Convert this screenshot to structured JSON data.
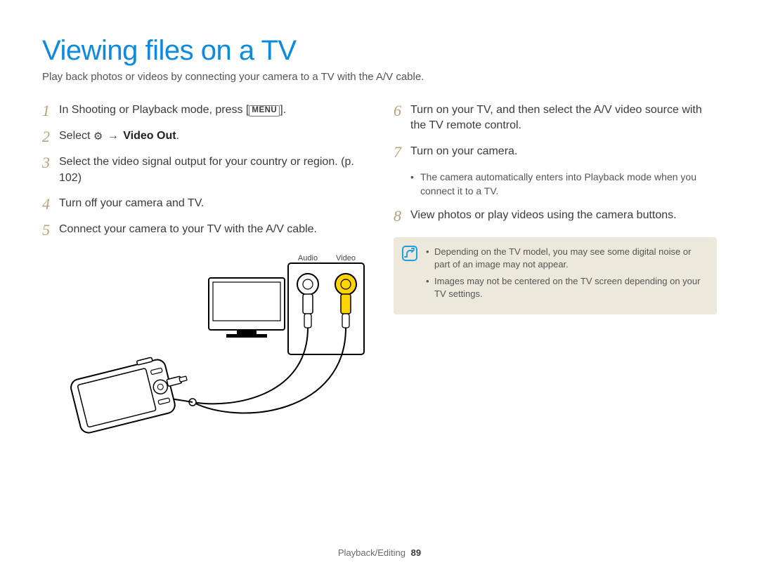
{
  "title": "Viewing files on a TV",
  "intro": "Play back photos or videos by connecting your camera to a TV with the A/V cable.",
  "left_steps": [
    {
      "num": "1",
      "text_pre": "In Shooting or Playback mode, press [",
      "menu_label": "MENU",
      "text_post": "]."
    },
    {
      "num": "2",
      "text_pre": "Select ",
      "gear": "⚙",
      "arrow": "→",
      "bold": "Video Out",
      "text_post": "."
    },
    {
      "num": "3",
      "text": "Select the video signal output for your country or region. (p. 102)"
    },
    {
      "num": "4",
      "text": "Turn off your camera and TV."
    },
    {
      "num": "5",
      "text": "Connect your camera to your TV with the A/V cable."
    }
  ],
  "diagram": {
    "audio_label": "Audio",
    "video_label": "Video"
  },
  "right_steps": [
    {
      "num": "6",
      "text": "Turn on your TV, and then select the A/V video source with the TV remote control."
    },
    {
      "num": "7",
      "text": "Turn on your camera.",
      "sub": [
        "The camera automatically enters into Playback mode when you connect it to a TV."
      ]
    },
    {
      "num": "8",
      "text": "View photos or play videos using the camera buttons."
    }
  ],
  "notes": [
    "Depending on the TV model, you may see some digital noise or part of an image may not appear.",
    "Images may not be centered on the TV screen depending on your TV settings."
  ],
  "footer_section": "Playback/Editing",
  "footer_page": "89"
}
